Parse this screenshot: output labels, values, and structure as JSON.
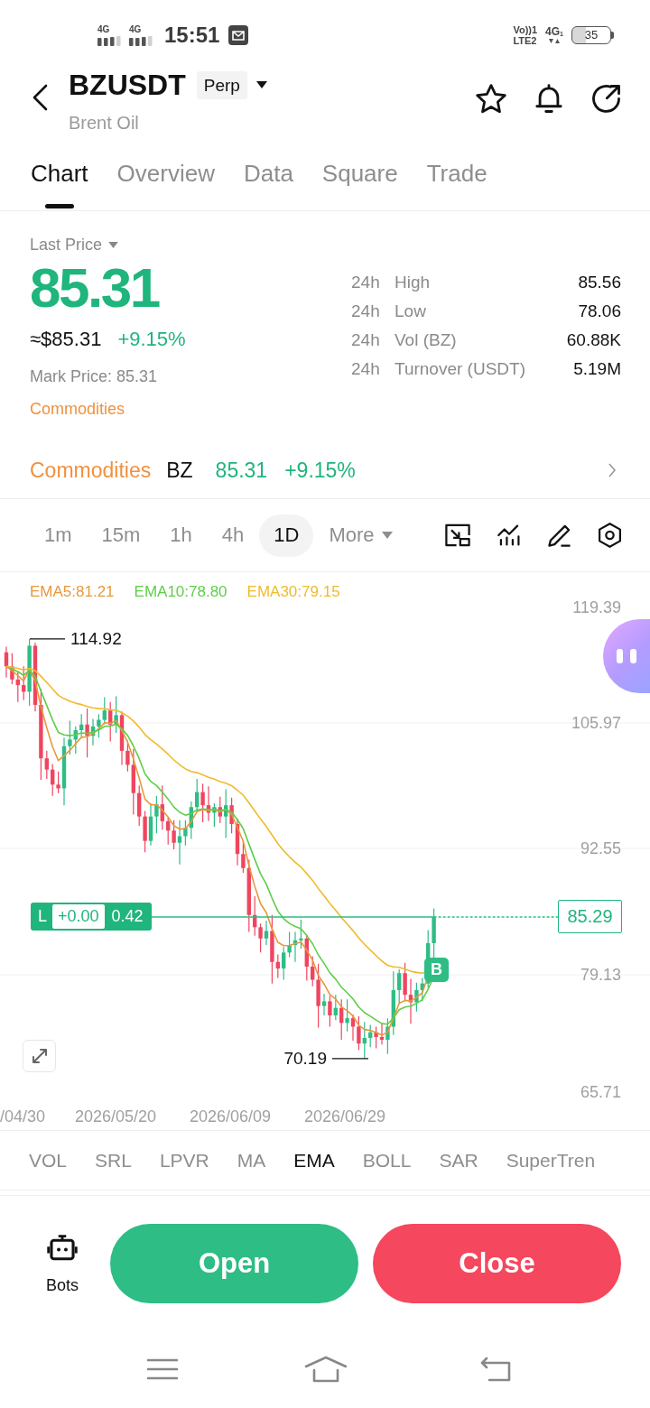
{
  "status_bar": {
    "signals": [
      {
        "label": "4G"
      },
      {
        "label": "4G"
      }
    ],
    "time": "15:51",
    "volte": [
      "Vo))1",
      "LTE2"
    ],
    "network": "4G",
    "network_slot": "1",
    "battery": "35"
  },
  "header": {
    "symbol": "BZUSDT",
    "badge": "Perp",
    "subtitle": "Brent Oil"
  },
  "tabs": [
    {
      "label": "Chart",
      "selected": true
    },
    {
      "label": "Overview",
      "selected": false
    },
    {
      "label": "Data",
      "selected": false
    },
    {
      "label": "Square",
      "selected": false
    },
    {
      "label": "Trade",
      "selected": false
    }
  ],
  "price": {
    "label": "Last Price",
    "value": "85.31",
    "usd_value": "≈$85.31",
    "change": "+9.15%",
    "mark_price": "Mark Price: 85.31",
    "category": "Commodities"
  },
  "stats_24h": [
    {
      "period": "24h",
      "label": "High",
      "value": "85.56"
    },
    {
      "period": "24h",
      "label": "Low",
      "value": "78.06"
    },
    {
      "period": "24h",
      "label": "Vol (BZ)",
      "value": "60.88K"
    },
    {
      "period": "24h",
      "label": "Turnover (USDT)",
      "value": "5.19M"
    }
  ],
  "sector": {
    "name": "Commodities",
    "symbol": "BZ",
    "price": "85.31",
    "change": "+9.15%"
  },
  "intervals": [
    {
      "label": "1m",
      "selected": false
    },
    {
      "label": "15m",
      "selected": false
    },
    {
      "label": "1h",
      "selected": false
    },
    {
      "label": "4h",
      "selected": false
    },
    {
      "label": "1D",
      "selected": true
    }
  ],
  "more": "More",
  "chart": {
    "ema_legend": [
      {
        "label": "EMA5:81.21",
        "color": "#e8983e"
      },
      {
        "label": "EMA10:78.80",
        "color": "#5fce4a"
      },
      {
        "label": "EMA30:79.15",
        "color": "#efbb2c"
      }
    ],
    "price_axis": [
      "119.39",
      "105.97",
      "92.55",
      "79.13",
      "65.71"
    ],
    "date_axis": [
      "/04/30",
      "2026/05/20",
      "2026/06/09",
      "2026/06/29"
    ],
    "high_label": "114.92",
    "low_label": "70.19",
    "position": {
      "side": "L",
      "pnl": "+0.00",
      "size": "0.42"
    },
    "last_price": "85.29",
    "trade_marker": "B"
  },
  "indicators": [
    {
      "label": "VOL",
      "selected": false
    },
    {
      "label": "SRL",
      "selected": false
    },
    {
      "label": "LPVR",
      "selected": false
    },
    {
      "label": "MA",
      "selected": false
    },
    {
      "label": "EMA",
      "selected": true
    },
    {
      "label": "BOLL",
      "selected": false
    },
    {
      "label": "SAR",
      "selected": false
    },
    {
      "label": "SuperTren",
      "selected": false
    }
  ],
  "actions": {
    "bots": "Bots",
    "buttons": [
      {
        "label": "Open",
        "kind": "open"
      },
      {
        "label": "Close",
        "kind": "close"
      }
    ]
  }
}
